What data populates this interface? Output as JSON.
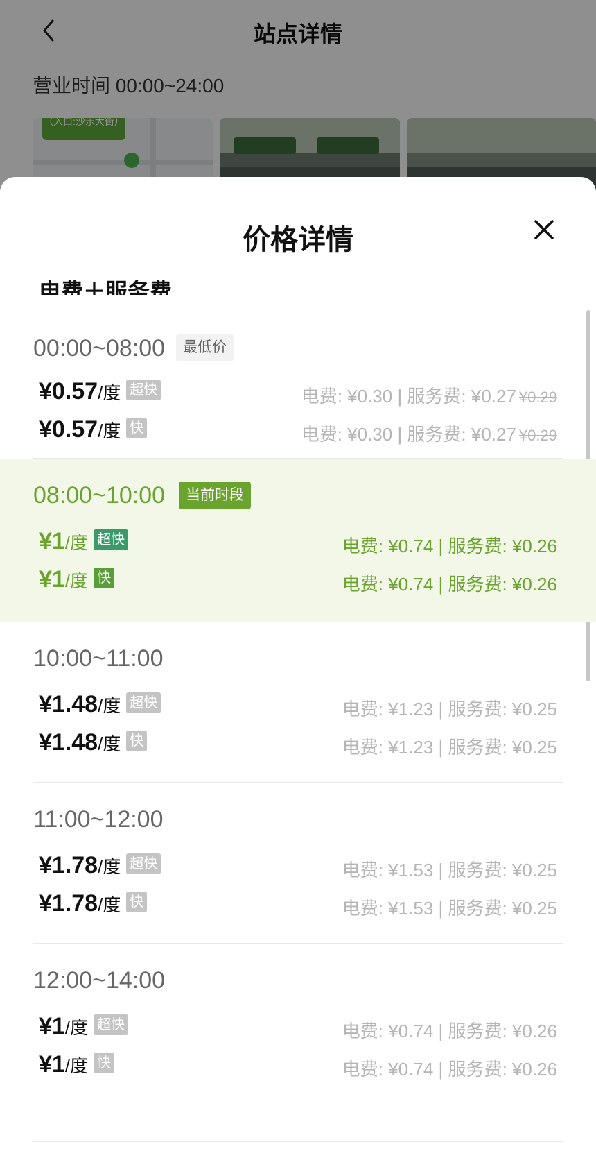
{
  "background": {
    "title": "站点详情",
    "hours": "营业时间 00:00~24:00",
    "map_tag": "（入口:沙乐大街）"
  },
  "sheet": {
    "title": "价格详情",
    "section_label": "电费＋服务费",
    "blocks": [
      {
        "time": "00:00~08:00",
        "tag": "最低价",
        "rows": [
          {
            "price": "¥0.57",
            "unit": "/度",
            "badge": "超快",
            "detail": "电费: ¥0.30 | 服务费: ¥0.27",
            "original": "¥0.29"
          },
          {
            "price": "¥0.57",
            "unit": "/度",
            "badge": "快",
            "detail": "电费: ¥0.30 | 服务费: ¥0.27",
            "original": "¥0.29"
          }
        ]
      },
      {
        "time": "08:00~10:00",
        "tag": "当前时段",
        "rows": [
          {
            "price": "¥1",
            "unit": "/度",
            "badge": "超快",
            "detail": "电费: ¥0.74 | 服务费: ¥0.26"
          },
          {
            "price": "¥1",
            "unit": "/度",
            "badge": "快",
            "detail": "电费: ¥0.74 | 服务费: ¥0.26"
          }
        ]
      },
      {
        "time": "10:00~11:00",
        "rows": [
          {
            "price": "¥1.48",
            "unit": "/度",
            "badge": "超快",
            "detail": "电费: ¥1.23 | 服务费: ¥0.25"
          },
          {
            "price": "¥1.48",
            "unit": "/度",
            "badge": "快",
            "detail": "电费: ¥1.23 | 服务费: ¥0.25"
          }
        ]
      },
      {
        "time": "11:00~12:00",
        "rows": [
          {
            "price": "¥1.78",
            "unit": "/度",
            "badge": "超快",
            "detail": "电费: ¥1.53 | 服务费: ¥0.25"
          },
          {
            "price": "¥1.78",
            "unit": "/度",
            "badge": "快",
            "detail": "电费: ¥1.53 | 服务费: ¥0.25"
          }
        ]
      },
      {
        "time": "12:00~14:00",
        "rows": [
          {
            "price": "¥1",
            "unit": "/度",
            "badge": "超快",
            "detail": "电费: ¥0.74 | 服务费: ¥0.26"
          },
          {
            "price": "¥1",
            "unit": "/度",
            "badge": "快",
            "detail": "电费: ¥0.74 | 服务费: ¥0.26"
          }
        ]
      }
    ]
  },
  "colors": {
    "accent_green": "#6aa42f",
    "current_bg": "#f2f7e8",
    "muted_text": "#b5b5b5"
  },
  "icons": {
    "back": "chevron-left-icon",
    "close": "close-icon"
  }
}
